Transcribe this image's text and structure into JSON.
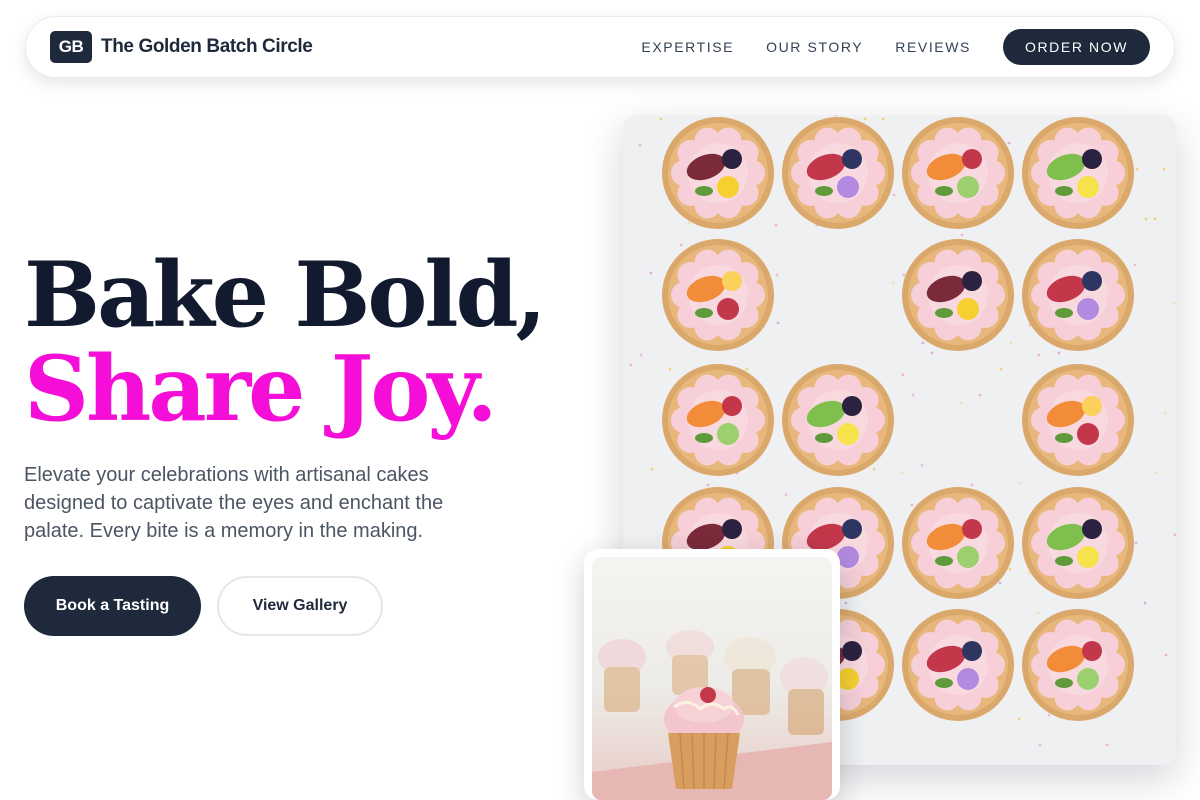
{
  "brand": {
    "mark": "GB",
    "name": "The Golden Batch Circle"
  },
  "nav": {
    "links": [
      "EXPERTISE",
      "OUR STORY",
      "REVIEWS"
    ],
    "cta": "ORDER NOW"
  },
  "hero": {
    "headline_line1": "Bake Bold,",
    "headline_line2": "Share Joy.",
    "subtext": "Elevate your celebrations with artisanal cakes designed to captivate the eyes and enchant the palate. Every bite is a memory in the making.",
    "primary_button": "Book a Tasting",
    "secondary_button": "View Gallery"
  },
  "colors": {
    "dark": "#1e293b",
    "accent": "#f50ed7",
    "body_text": "#4b5563"
  }
}
